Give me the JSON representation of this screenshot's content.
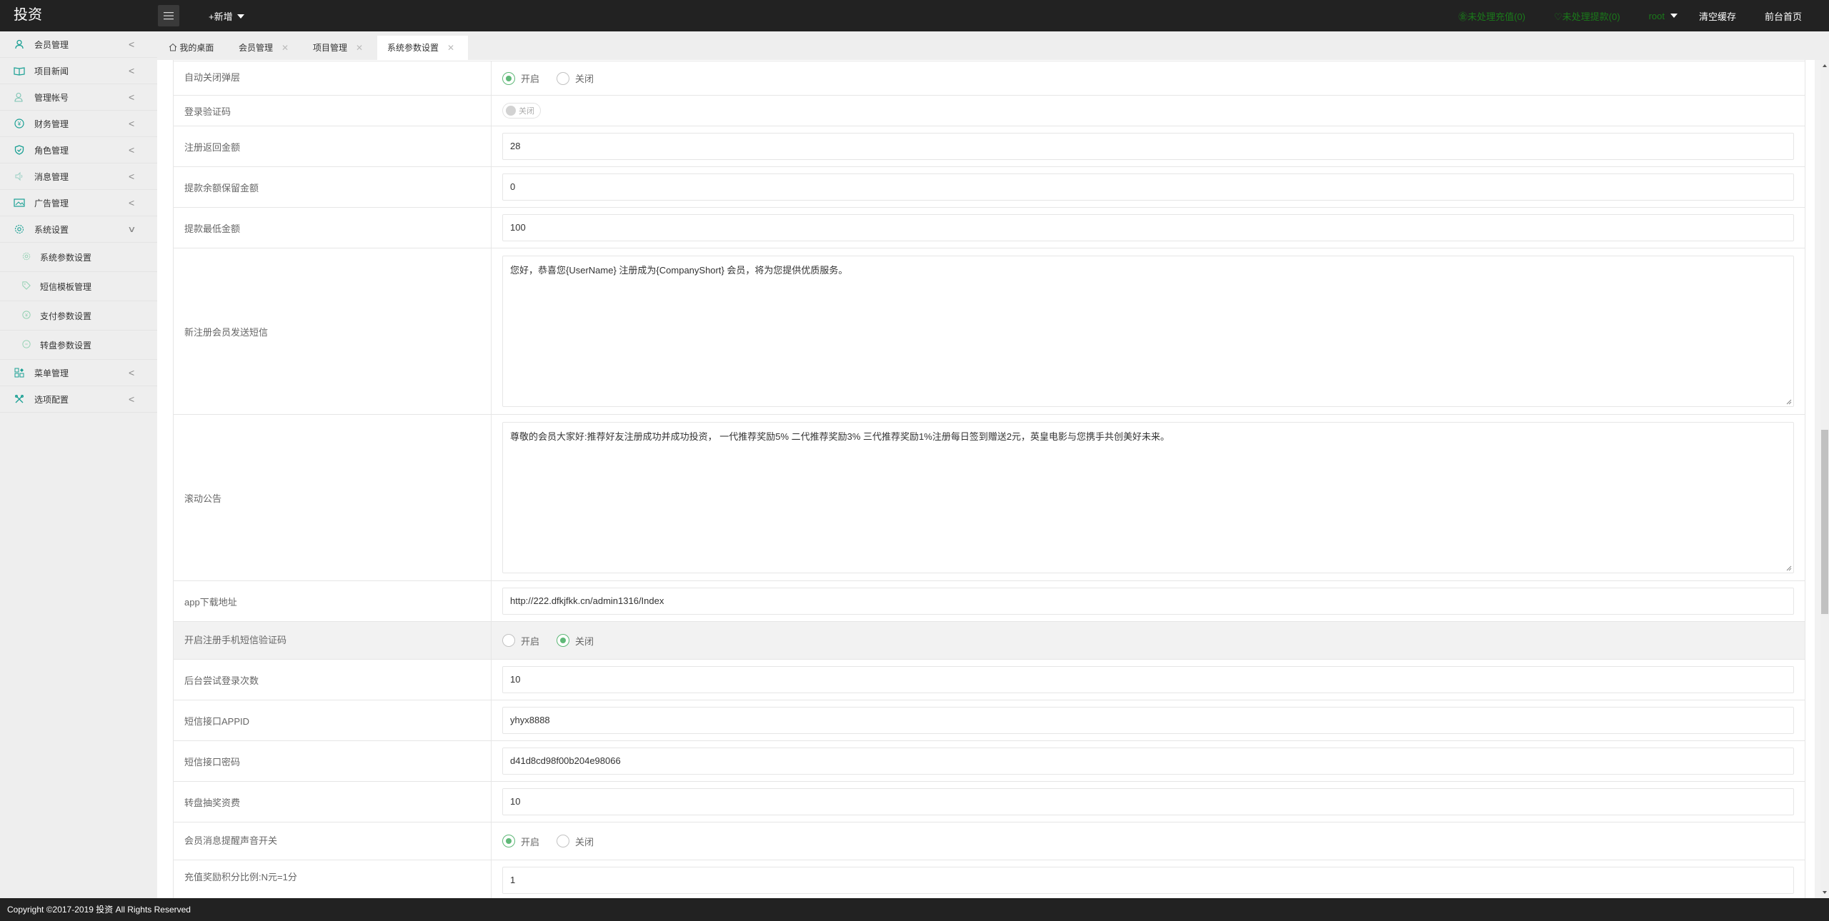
{
  "header": {
    "logo": "投资",
    "add_new_label": "+新增",
    "pending_recharge": "㊎未处理充值(0)",
    "pending_withdraw": "♡未处理提款(0)",
    "user": "root",
    "clear_cache": "清空缓存",
    "front_home": "前台首页",
    "accent_green": "#1a7a1a"
  },
  "sidebar": {
    "items": [
      {
        "label": "会员管理",
        "icon": "user-icon",
        "expanded": false
      },
      {
        "label": "项目新闻",
        "icon": "book-icon",
        "expanded": false
      },
      {
        "label": "管理帐号",
        "icon": "users-icon",
        "expanded": false
      },
      {
        "label": "财务管理",
        "icon": "yen-icon",
        "expanded": false
      },
      {
        "label": "角色管理",
        "icon": "shield-icon",
        "expanded": false
      },
      {
        "label": "消息管理",
        "icon": "speaker-icon",
        "expanded": false
      },
      {
        "label": "广告管理",
        "icon": "image-icon",
        "expanded": false
      },
      {
        "label": "系统设置",
        "icon": "gear-icon",
        "expanded": true
      }
    ],
    "sub_items": [
      {
        "label": "系统参数设置",
        "icon": "gear-icon"
      },
      {
        "label": "短信模板管理",
        "icon": "tag-icon"
      },
      {
        "label": "支付参数设置",
        "icon": "yen-icon"
      },
      {
        "label": "转盘参数设置",
        "icon": "dial-icon"
      }
    ],
    "after_items": [
      {
        "label": "菜单管理",
        "icon": "grid-icon",
        "expanded": false
      },
      {
        "label": "选项配置",
        "icon": "tools-icon",
        "expanded": false
      }
    ]
  },
  "tabs": [
    {
      "label": "我的桌面",
      "closable": false,
      "active": false
    },
    {
      "label": "会员管理",
      "closable": true,
      "active": false
    },
    {
      "label": "项目管理",
      "closable": true,
      "active": false
    },
    {
      "label": "系统参数设置",
      "closable": true,
      "active": true
    }
  ],
  "form": {
    "rows": [
      {
        "label": "自动关闭弹层",
        "type": "radio",
        "options": [
          "开启",
          "关闭"
        ],
        "selected": "开启"
      },
      {
        "label": "登录验证码",
        "type": "switch",
        "state_label": "关闭",
        "disabled": true
      },
      {
        "label": "注册返回金额",
        "type": "input",
        "value": "28"
      },
      {
        "label": "提款余额保留金额",
        "type": "input",
        "value": "0"
      },
      {
        "label": "提款最低金额",
        "type": "input",
        "value": "100"
      },
      {
        "label": "新注册会员发送短信",
        "type": "textarea",
        "value": "您好，恭喜您{UserName} 注册成为{CompanyShort} 会员，将为您提供优质服务。"
      },
      {
        "label": "滚动公告",
        "type": "textarea",
        "value": "尊敬的会员大家好:推荐好友注册成功并成功投资， 一代推荐奖励5%  二代推荐奖励3%  三代推荐奖励1%注册每日签到赠送2元，英皇电影与您携手共创美好未来。"
      },
      {
        "label": "app下载地址",
        "type": "input",
        "value": "http://222.dfkjfkk.cn/admin1316/Index"
      },
      {
        "label": "开启注册手机短信验证码",
        "type": "radio",
        "options": [
          "开启",
          "关闭"
        ],
        "selected": "关闭"
      },
      {
        "label": "后台尝试登录次数",
        "type": "input",
        "value": "10"
      },
      {
        "label": "短信接口APPID",
        "type": "input",
        "value": "yhyx8888"
      },
      {
        "label": "短信接口密码",
        "type": "input",
        "value": "d41d8cd98f00b204e98066"
      },
      {
        "label": "转盘抽奖资费",
        "type": "input",
        "value": "10"
      },
      {
        "label": "会员消息提醒声音开关",
        "type": "radio",
        "options": [
          "开启",
          "关闭"
        ],
        "selected": "开启"
      },
      {
        "label": "充值奖励积分比例:N元=1分",
        "type": "input",
        "value": "1"
      }
    ]
  },
  "footer": {
    "copyright": "Copyright ©2017-2019 投资 All Rights Reserved"
  }
}
